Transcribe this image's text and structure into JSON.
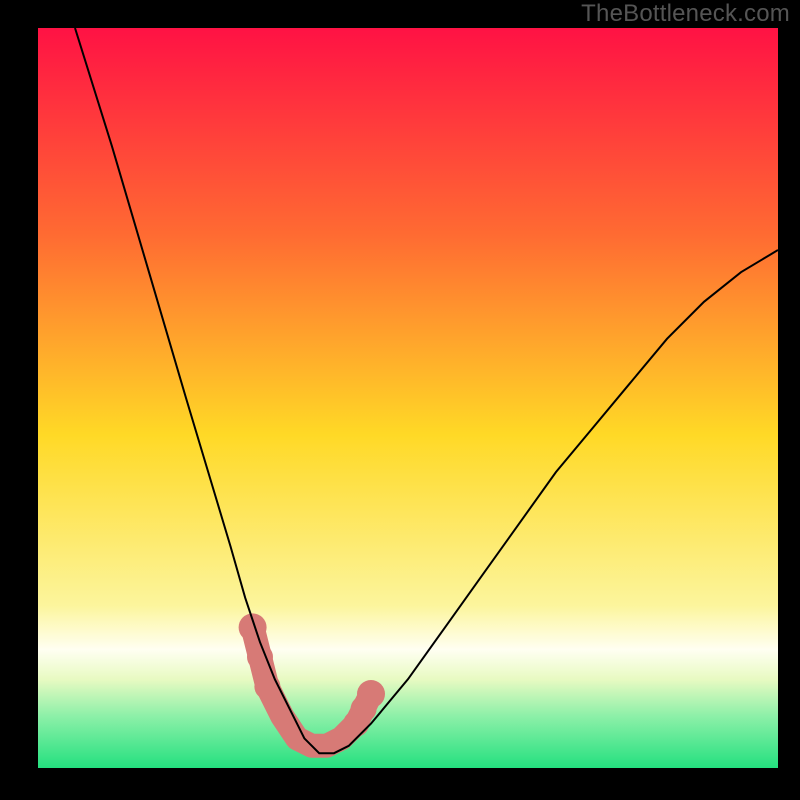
{
  "watermark": "TheBottleneck.com",
  "colors": {
    "frame": "#000000",
    "curve": "#000000",
    "band_mid": "#d77a76",
    "band_green": "#24e07f",
    "gradient_top": "#ff1244",
    "gradient_upper_mid": "#ff6b32",
    "gradient_mid": "#ffd926",
    "gradient_lower_mid": "#fbf69a",
    "gradient_bottom": "#24e07f",
    "watermark_color": "#555555"
  },
  "chart_data": {
    "type": "line",
    "title": "",
    "xlabel": "",
    "ylabel": "",
    "xlim": [
      0,
      100
    ],
    "ylim": [
      0,
      100
    ],
    "background_gradient": {
      "stops": [
        {
          "offset": 0.0,
          "color": "#ff1244"
        },
        {
          "offset": 0.28,
          "color": "#ff6b32"
        },
        {
          "offset": 0.55,
          "color": "#ffd926"
        },
        {
          "offset": 0.78,
          "color": "#fcf59c"
        },
        {
          "offset": 0.84,
          "color": "#fffff2"
        },
        {
          "offset": 0.88,
          "color": "#e8fac2"
        },
        {
          "offset": 0.93,
          "color": "#8cf0a8"
        },
        {
          "offset": 1.0,
          "color": "#24e07f"
        }
      ]
    },
    "series": [
      {
        "name": "bottleneck-curve",
        "color": "#000000",
        "x": [
          5,
          10,
          15,
          20,
          23,
          26,
          28,
          30,
          32,
          34,
          35,
          36,
          37,
          38,
          39,
          40,
          42,
          45,
          50,
          55,
          60,
          65,
          70,
          75,
          80,
          85,
          90,
          95,
          100
        ],
        "y": [
          100,
          84,
          67,
          50,
          40,
          30,
          23,
          17,
          12,
          8,
          6,
          4,
          3,
          2,
          2,
          2,
          3,
          6,
          12,
          19,
          26,
          33,
          40,
          46,
          52,
          58,
          63,
          67,
          70
        ]
      }
    ],
    "highlight_band": {
      "name": "optimal-region",
      "color": "#d77a76",
      "points": [
        {
          "x": 29,
          "y": 19
        },
        {
          "x": 30,
          "y": 15
        },
        {
          "x": 31,
          "y": 11
        },
        {
          "x": 33,
          "y": 7
        },
        {
          "x": 35,
          "y": 4
        },
        {
          "x": 37,
          "y": 3
        },
        {
          "x": 39,
          "y": 3
        },
        {
          "x": 41,
          "y": 4
        },
        {
          "x": 43,
          "y": 6
        },
        {
          "x": 44,
          "y": 8
        },
        {
          "x": 45,
          "y": 10
        }
      ]
    }
  }
}
